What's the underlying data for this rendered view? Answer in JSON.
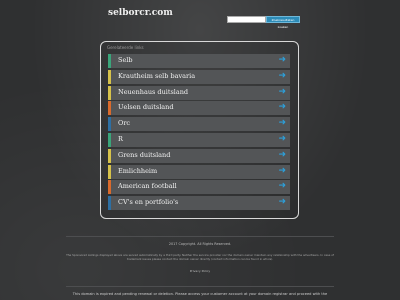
{
  "header": {
    "logo": "selborcr.com",
    "search_placeholder": "",
    "search_button_label": "Zoekresultaten zoeken"
  },
  "panel": {
    "related_label": "Gerelateerde links",
    "links": [
      {
        "label": "Selb",
        "accent": "#3aa57a"
      },
      {
        "label": "Krautheim selb bavaria",
        "accent": "#d6c24a"
      },
      {
        "label": "Neuenhaus duitsland",
        "accent": "#d6c24a"
      },
      {
        "label": "Uelsen duitsland",
        "accent": "#d96a2c"
      },
      {
        "label": "Orc",
        "accent": "#2d6fa3"
      },
      {
        "label": "R",
        "accent": "#3aa57a"
      },
      {
        "label": "Grens duitsland",
        "accent": "#d6c24a"
      },
      {
        "label": "Emlichheim",
        "accent": "#d6c24a"
      },
      {
        "label": "American football",
        "accent": "#d96a2c"
      },
      {
        "label": "CV's en portfolio's",
        "accent": "#2d6fa3"
      }
    ],
    "arrow_icon": "arrow-right-icon"
  },
  "footer": {
    "copyright": "2017 Copyright. All Rights Reserved.",
    "disclaimer": "The Sponsored Listings displayed above are served automatically by a third party. Neither the service provider nor the domain owner maintain any relationship with the advertisers. In case of trademark issues please contact the domain owner directly (contact information can be found in whois).",
    "privacy": "Privacy Policy",
    "notice": "This domain is expired and pending renewal or deletion. Please access your customer account at your domain registrar and proceed with the"
  }
}
